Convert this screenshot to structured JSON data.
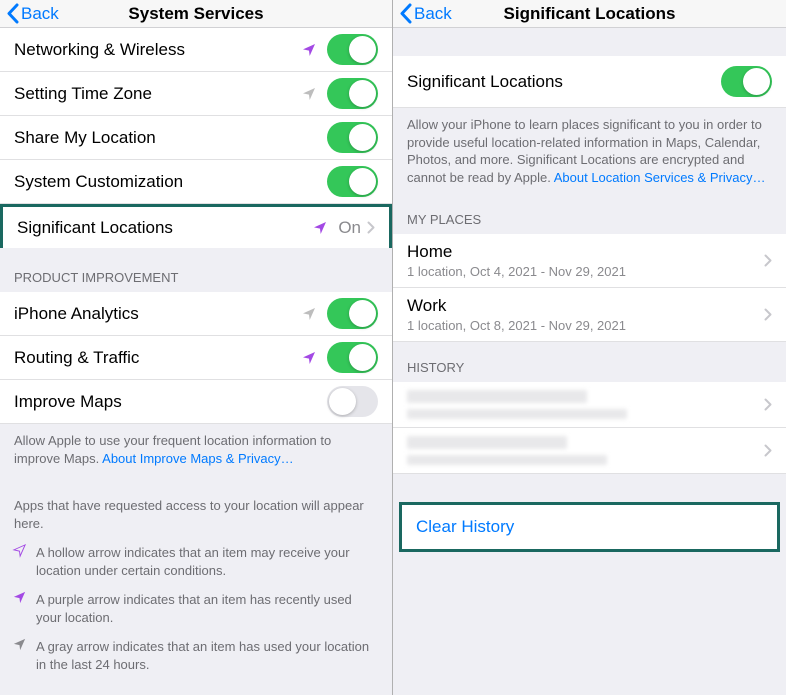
{
  "left": {
    "back": "Back",
    "title": "System Services",
    "rows": {
      "networking": "Networking & Wireless",
      "timezone": "Setting Time Zone",
      "share": "Share My Location",
      "custom": "System Customization",
      "sigloc": "Significant Locations",
      "sigloc_status": "On",
      "analytics": "iPhone Analytics",
      "routing": "Routing & Traffic",
      "improve": "Improve Maps"
    },
    "sections": {
      "product": "PRODUCT IMPROVEMENT"
    },
    "footers": {
      "improve": "Allow Apple to use your frequent location information to improve Maps. ",
      "improve_link": "About Improve Maps & Privacy…",
      "apps": "Apps that have requested access to your location will appear here."
    },
    "legend": {
      "hollow": "A hollow arrow indicates that an item may receive your location under certain conditions.",
      "purple": "A purple arrow indicates that an item has recently used your location.",
      "gray": "A gray arrow indicates that an item has used your location in the last 24 hours."
    }
  },
  "right": {
    "back": "Back",
    "title": "Significant Locations",
    "rows": {
      "sigloc": "Significant Locations"
    },
    "footers": {
      "desc": "Allow your iPhone to learn places significant to you in order to provide useful location-related information in Maps, Calendar, Photos, and more. Significant Locations are encrypted and cannot be read by Apple. ",
      "desc_link": "About Location Services & Privacy…"
    },
    "sections": {
      "places": "MY PLACES",
      "history": "HISTORY"
    },
    "places": {
      "home": {
        "title": "Home",
        "sub": "1 location, Oct 4, 2021 - Nov 29, 2021"
      },
      "work": {
        "title": "Work",
        "sub": "1 location, Oct 8, 2021 - Nov 29, 2021"
      }
    },
    "clear": "Clear History"
  }
}
